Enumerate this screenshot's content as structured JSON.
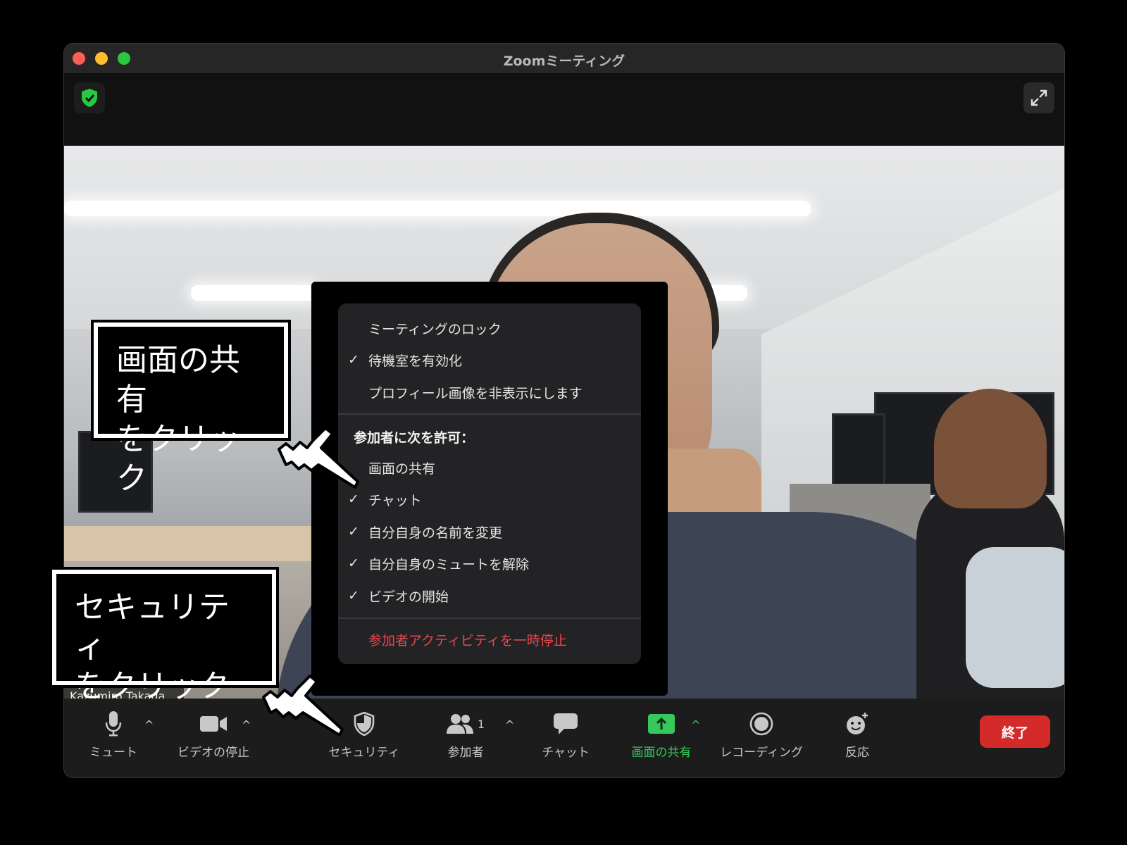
{
  "window": {
    "title": "Zoomミーティング"
  },
  "video": {
    "participant_name": "Kazumiro Takada"
  },
  "security_menu": {
    "items_top": [
      {
        "label": "ミーティングのロック",
        "checked": false
      },
      {
        "label": "待機室を有効化",
        "checked": true
      },
      {
        "label": "プロフィール画像を非表示にします",
        "checked": false
      }
    ],
    "allow_header": "参加者に次を許可：",
    "allow_items": [
      {
        "label": "画面の共有",
        "checked": false
      },
      {
        "label": "チャット",
        "checked": true
      },
      {
        "label": "自分自身の名前を変更",
        "checked": true
      },
      {
        "label": "自分自身のミュートを解除",
        "checked": true
      },
      {
        "label": "ビデオの開始",
        "checked": true
      }
    ],
    "suspend_label": "参加者アクティビティを一時停止",
    "check_glyph": "✓"
  },
  "callouts": {
    "share": [
      "画面の共有",
      "をクリック"
    ],
    "security": [
      "セキュリティ",
      "をクリック"
    ]
  },
  "toolbar": {
    "mute": "ミュート",
    "video": "ビデオの停止",
    "security": "セキュリティ",
    "participants": "参加者",
    "participants_count": "1",
    "chat": "チャット",
    "share": "画面の共有",
    "record": "レコーディング",
    "reactions": "反応",
    "end": "終了",
    "caret": "^"
  },
  "colors": {
    "share_green": "#36c85a",
    "end_red": "#d42a2a",
    "danger_text": "#e5484d",
    "shield_green": "#28c840"
  }
}
